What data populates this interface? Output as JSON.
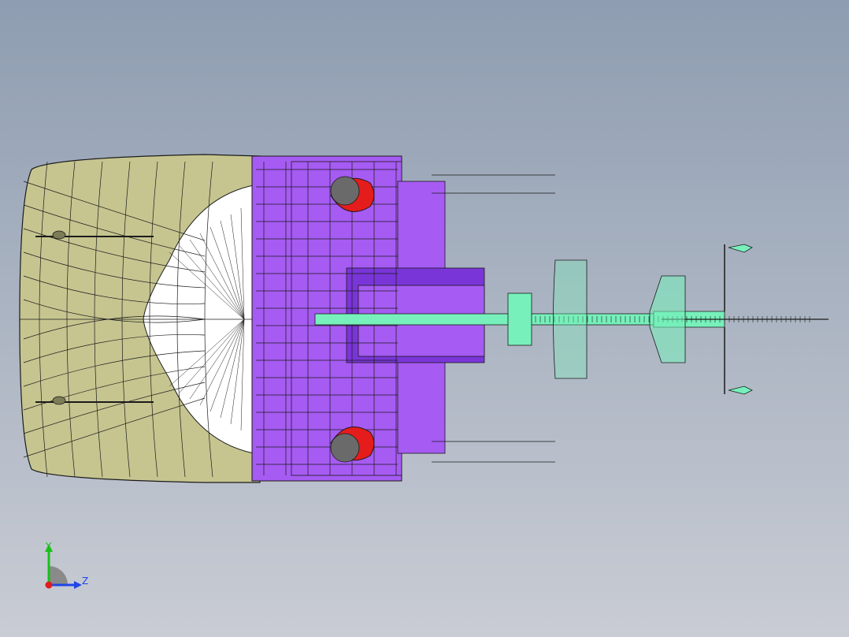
{
  "viewport": {
    "colors": {
      "background_top": "#8e9db1",
      "background_bottom": "#c9ccd4",
      "hull": "#c6c590",
      "hull_light": "#eeeec2",
      "superstructure": "#a65bf2",
      "superstructure_dark": "#7a35d8",
      "mast": "#77f0bb",
      "lifeboat": "#e51c1c",
      "outline": "#1b1b1b"
    }
  },
  "triad": {
    "y_label": "Y",
    "z_label": "Z",
    "y_color": "#19c019",
    "z_color": "#1f46e6",
    "origin_color": "#e01c1c"
  }
}
